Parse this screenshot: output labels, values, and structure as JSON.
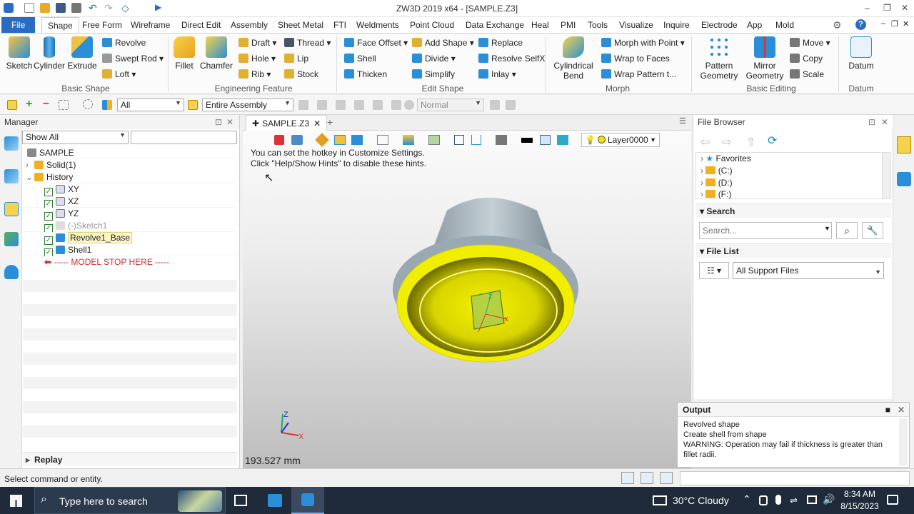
{
  "window": {
    "title": "ZW3D 2019  x64 - [SAMPLE.Z3]",
    "controls": {
      "minimize": "–",
      "restore": "❐",
      "close": "✕"
    }
  },
  "menu": {
    "file": "File",
    "tabs": [
      "Shape",
      "Free Form",
      "Wireframe",
      "Direct Edit",
      "Assembly",
      "Sheet Metal",
      "FTI",
      "Weldments",
      "Point Cloud",
      "Data Exchange",
      "Heal",
      "PMI",
      "Tools",
      "Visualize",
      "Inquire",
      "Electrode",
      "App",
      "Mold"
    ],
    "active_tab": "Shape"
  },
  "ribbon": {
    "basic_shape": {
      "label": "Basic Shape",
      "big": [
        "Sketch",
        "Cylinder",
        "Extrude"
      ],
      "small": [
        "Revolve",
        "Swept Rod",
        "Loft"
      ]
    },
    "engineering_feature": {
      "label": "Engineering Feature",
      "big": [
        "Fillet",
        "Chamfer"
      ],
      "small": [
        "Draft",
        "Hole",
        "Rib",
        "Thread",
        "Lip",
        "Stock"
      ]
    },
    "edit_shape": {
      "label": "Edit Shape",
      "small": [
        "Face Offset",
        "Shell",
        "Thicken",
        "Add Shape",
        "Divide",
        "Simplify",
        "Replace",
        "Resolve SelfX",
        "Inlay"
      ]
    },
    "morph": {
      "label": "Morph",
      "big": [
        "Cylindrical Bend"
      ],
      "small": [
        "Morph with Point",
        "Wrap to Faces",
        "Wrap Pattern t..."
      ]
    },
    "basic_editing": {
      "label": "Basic Editing",
      "big": [
        "Pattern Geometry",
        "Mirror Geometry"
      ],
      "small": [
        "Move",
        "Copy",
        "Scale"
      ]
    },
    "datum": {
      "label": "Datum",
      "big": [
        "Datum"
      ]
    }
  },
  "toolbar": {
    "filter": "All",
    "scope": "Entire Assembly",
    "mode": "Normal"
  },
  "manager": {
    "title": "Manager",
    "filter": "Show All",
    "tree": [
      {
        "label": "SAMPLE",
        "level": 0
      },
      {
        "label": "Solid(1)",
        "level": 1
      },
      {
        "label": "History",
        "level": 1
      },
      {
        "label": "XY",
        "level": 2,
        "checked": true
      },
      {
        "label": "XZ",
        "level": 2,
        "checked": true
      },
      {
        "label": "YZ",
        "level": 2,
        "checked": true
      },
      {
        "label": "(-)Sketch1",
        "level": 2,
        "checked": true,
        "dim": true
      },
      {
        "label": "Revolve1_Base",
        "level": 2,
        "checked": true,
        "highlight": true
      },
      {
        "label": "Shell1",
        "level": 2,
        "checked": true
      },
      {
        "label": "----- MODEL STOP HERE -----",
        "level": 1,
        "stop": true
      }
    ],
    "replay": "Replay"
  },
  "viewport": {
    "tab": "SAMPLE.Z3",
    "hint1": "You can set the hotkey in Customize Settings.",
    "hint2": "Click \"Help/Show Hints\" to disable these hints.",
    "layer": "Layer0000",
    "measure": "193.527 mm",
    "axes": {
      "x": "X",
      "y": "Y",
      "z": "Z"
    }
  },
  "file_browser": {
    "title": "File Browser",
    "folders": [
      "Favorites",
      "(C:)",
      "(D:)",
      "(F:)"
    ],
    "search_label": "Search",
    "search_placeholder": "Search...",
    "file_list_label": "File List",
    "file_filter": "All Support Files"
  },
  "output": {
    "title": "Output",
    "lines": [
      "Revolved shape",
      "Create shell from shape",
      "WARNING: Operation may fail if thickness is greater than fillet radii."
    ]
  },
  "status": {
    "text": "Select command or entity."
  },
  "taskbar": {
    "search_placeholder": "Type here to search",
    "weather": "30°C  Cloudy",
    "time": "8:34 AM",
    "date": "8/15/2023"
  },
  "colors": {
    "accent": "#2a6cc4",
    "model_yellow": "#f2ee00",
    "model_gray": "#a6b3bb"
  }
}
